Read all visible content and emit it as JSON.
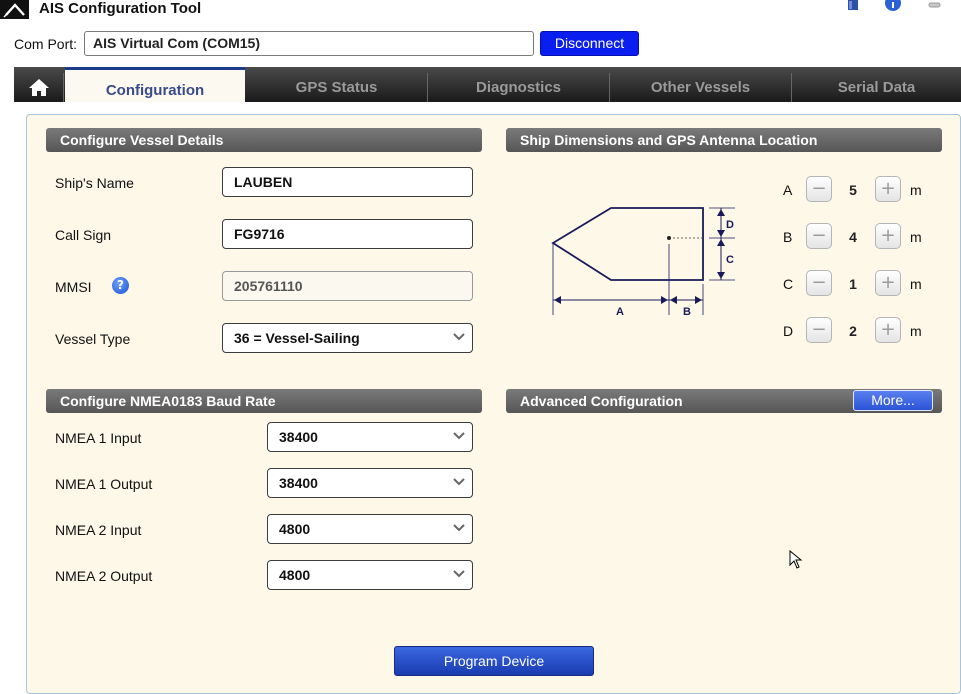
{
  "window": {
    "title": "AIS Configuration Tool"
  },
  "com_port": {
    "label": "Com Port:",
    "value": "AIS Virtual Com (COM15)",
    "disconnect_label": "Disconnect"
  },
  "tabs": [
    {
      "label": "Configuration"
    },
    {
      "label": "GPS Status"
    },
    {
      "label": "Diagnostics"
    },
    {
      "label": "Other Vessels"
    },
    {
      "label": "Serial Data"
    }
  ],
  "vessel": {
    "heading": "Configure Vessel Details",
    "ship_name_label": "Ship's Name",
    "ship_name": "LAUBEN",
    "call_sign_label": "Call Sign",
    "call_sign": "FG9716",
    "mmsi_label": "MMSI",
    "mmsi": "205761110",
    "help_glyph": "?",
    "vessel_type_label": "Vessel Type",
    "vessel_type": "36 = Vessel-Sailing"
  },
  "dimensions": {
    "heading": "Ship Dimensions and GPS Antenna Location",
    "diagram_labels": {
      "a": "A",
      "b": "B",
      "c": "C",
      "d": "D"
    },
    "items": [
      {
        "label": "A",
        "value": "5",
        "unit": "m"
      },
      {
        "label": "B",
        "value": "4",
        "unit": "m"
      },
      {
        "label": "C",
        "value": "1",
        "unit": "m"
      },
      {
        "label": "D",
        "value": "2",
        "unit": "m"
      }
    ],
    "minus": "−",
    "plus": "+"
  },
  "baud": {
    "heading": "Configure NMEA0183 Baud Rate",
    "rows": [
      {
        "label": "NMEA 1 Input",
        "value": "38400"
      },
      {
        "label": "NMEA 1 Output",
        "value": "38400"
      },
      {
        "label": "NMEA 2 Input",
        "value": "4800"
      },
      {
        "label": "NMEA 2 Output",
        "value": "4800"
      }
    ]
  },
  "advanced": {
    "heading": "Advanced Configuration",
    "more_label": "More..."
  },
  "program_label": "Program Device",
  "colors": {
    "tab_active_text": "#3a4a8e",
    "disconnect_bg": "#0b1ef0",
    "panel_bg": "#fdf8e8",
    "section_header": "#656565"
  }
}
